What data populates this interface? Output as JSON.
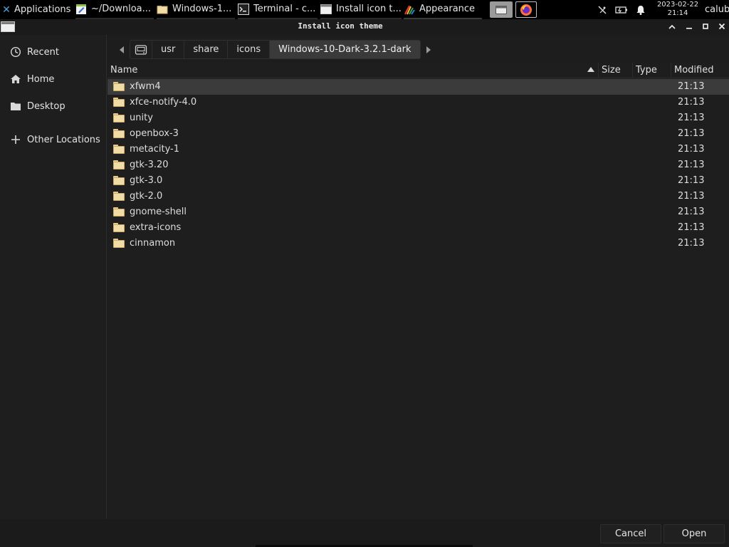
{
  "taskbar": {
    "apps_label": "Applications",
    "windows": [
      {
        "label": "~/Downloa...",
        "icon": "text-editor-icon"
      },
      {
        "label": "Windows-1...",
        "icon": "folder-icon"
      },
      {
        "label": "Terminal - c...",
        "icon": "terminal-icon"
      },
      {
        "label": "Install icon t...",
        "icon": "window-icon"
      },
      {
        "label": "Appearance",
        "icon": "appearance-icon"
      }
    ],
    "clock_date": "2023-02-22",
    "clock_time": "21:14",
    "user": "calub"
  },
  "dialog": {
    "title": "Install icon theme"
  },
  "sidebar": {
    "items": [
      {
        "label": "Recent",
        "icon": "clock-icon"
      },
      {
        "label": "Home",
        "icon": "home-icon"
      },
      {
        "label": "Desktop",
        "icon": "folder-icon"
      },
      {
        "label": "Other Locations",
        "icon": "plus-icon"
      }
    ]
  },
  "pathbar": {
    "crumbs": [
      "usr",
      "share",
      "icons",
      "Windows-10-Dark-3.2.1-dark"
    ]
  },
  "filelist": {
    "columns": [
      "Name",
      "Size",
      "Type",
      "Modified"
    ],
    "sort_column": "Name",
    "sort_direction": "ascending",
    "rows": [
      {
        "name": "xfwm4",
        "modified": "21:13",
        "selected": true
      },
      {
        "name": "xfce-notify-4.0",
        "modified": "21:13"
      },
      {
        "name": "unity",
        "modified": "21:13"
      },
      {
        "name": "openbox-3",
        "modified": "21:13"
      },
      {
        "name": "metacity-1",
        "modified": "21:13"
      },
      {
        "name": "gtk-3.20",
        "modified": "21:13"
      },
      {
        "name": "gtk-3.0",
        "modified": "21:13"
      },
      {
        "name": "gtk-2.0",
        "modified": "21:13"
      },
      {
        "name": "gnome-shell",
        "modified": "21:13"
      },
      {
        "name": "extra-icons",
        "modified": "21:13"
      },
      {
        "name": "cinnamon",
        "modified": "21:13"
      }
    ]
  },
  "buttons": {
    "cancel": "Cancel",
    "open": "Open"
  },
  "colors": {
    "background": "#1d1d1d",
    "selected_row": "#3b3b3b",
    "folder": "#f2dca6",
    "taskbar": "#000000"
  }
}
